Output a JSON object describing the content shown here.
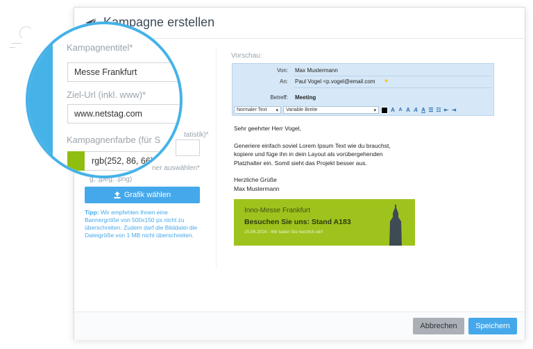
{
  "modal": {
    "title": "Kampagne erstellen"
  },
  "form": {
    "title_label": "Kampagnentitel*",
    "title_value": "Messe Frankfurt",
    "url_label": "Ziel-Url (inkl. www)*",
    "url_value": "www.netstag.com",
    "color_label_visible": "Kampagnenfarbe (für S",
    "color_label_rest": "tatistik)*",
    "color_value": "rgb(252, 86, 66)",
    "image_label_visible": "ner auswählen*",
    "image_formats_visible": "g, .jpeg, .png)",
    "upload_button": "Grafik wählen",
    "tip_bold": "Tipp:",
    "tip_text": " Wir empfehlen Ihnen eine Bannergröße von 500x150 px nicht zu überschreiten. Zudem darf die Bilddatei die Dateigröße von 1 MB nicht überschreiten."
  },
  "preview": {
    "label": "Vorschau:",
    "from_key": "Von:",
    "from_value": "Max Mustermann",
    "to_key": "An:",
    "to_value": "Paul Vogel <p.vogel@email.com",
    "subject_key": "Betreff:",
    "subject_value": "Meeting",
    "toolbar": {
      "format_select": "Normaler Text",
      "width_select": "Variable Breite"
    },
    "body": {
      "greeting": "Sehr geehrter Herr Vogel,",
      "para1": "Generiere einfach soviel Lorem Ipsum Text wie du brauchst, kopiere und füge ihn in dein Layout als vorübergehenden Platzhalter ein. Somit sieht das Projekt besser aus.",
      "closing": "Herzliche Grüße",
      "signature": "Max Mustermann"
    },
    "banner": {
      "line1": "Inno-Messe Frankfurt",
      "line2": "Besuchen Sie uns: Stand A183",
      "line3": "15.06.2016 - Wir laden Sie herzlich ein!"
    }
  },
  "footer": {
    "cancel": "Abbrechen",
    "save": "Speichern"
  },
  "colors": {
    "accent": "#45a8ea",
    "banner_green": "#9fc31d",
    "swatch_green": "#8fbe11"
  },
  "icons": [
    "paper-plane-icon",
    "upload-icon",
    "star-icon",
    "bold-icon",
    "italic-icon",
    "list-icon",
    "indent-icon"
  ]
}
